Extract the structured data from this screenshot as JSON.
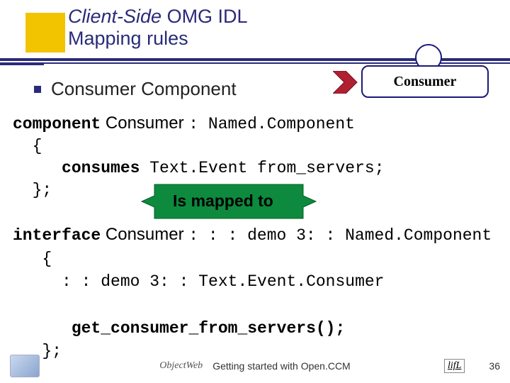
{
  "title": {
    "line1": "Client-Side",
    "line2": " OMG IDL",
    "line3": "Mapping rules"
  },
  "bullet": {
    "text": "Consumer Component"
  },
  "diagram": {
    "label": "Consumer"
  },
  "code1": {
    "l1_kw": "component",
    "l1_name": " Consumer ",
    "l1_rest": ": Named.Component",
    "l2": "  {",
    "l3_kw": "     consumes",
    "l3_rest": " Text.Event from_servers;",
    "l4": "  };"
  },
  "mapped": {
    "label": "Is mapped to"
  },
  "code2": {
    "l1_kw": "interface",
    "l1_name": " Consumer ",
    "l1_rest": ": : : demo 3: : Named.Component",
    "l2": "   {",
    "l3": "     : : demo 3: : Text.Event.Consumer",
    "l4": "",
    "l5": "      get_consumer_from_servers();",
    "l6": "   };"
  },
  "footer": {
    "center_logo": "ObjectWeb",
    "center_text": "Getting started with Open.CCM",
    "lifl": "lifL",
    "page": "36"
  }
}
